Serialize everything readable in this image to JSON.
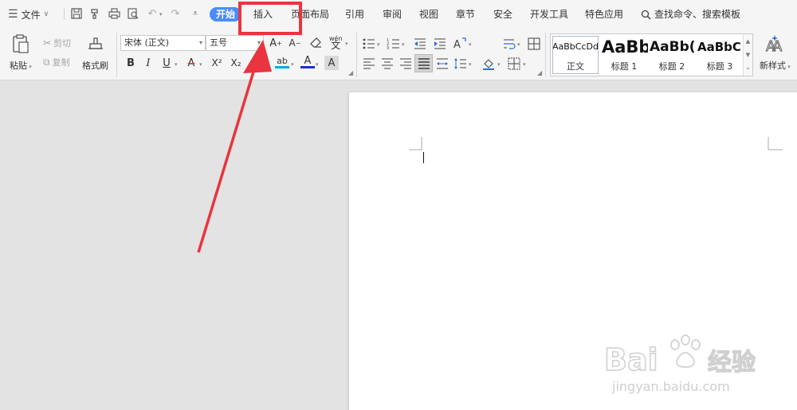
{
  "menubar": {
    "file_label": "文件",
    "tabs": [
      {
        "key": "home",
        "label": "开始",
        "active": true
      },
      {
        "key": "insert",
        "label": "插入",
        "active": false
      },
      {
        "key": "layout",
        "label": "页面布局",
        "active": false
      },
      {
        "key": "references",
        "label": "引用",
        "active": false
      },
      {
        "key": "review",
        "label": "审阅",
        "active": false
      },
      {
        "key": "view",
        "label": "视图",
        "active": false
      },
      {
        "key": "section",
        "label": "章节",
        "active": false
      },
      {
        "key": "security",
        "label": "安全",
        "active": false
      },
      {
        "key": "devtools",
        "label": "开发工具",
        "active": false
      },
      {
        "key": "features",
        "label": "特色应用",
        "active": false
      }
    ],
    "search_label": "查找命令、搜索模板",
    "quick_access_icons": [
      "save-icon",
      "format-painter-icon",
      "print-icon",
      "print-preview-icon",
      "undo-icon",
      "redo-icon",
      "customize-dropdown-icon"
    ]
  },
  "ribbon": {
    "paste_label": "粘贴",
    "cut_label": "剪切",
    "copy_label": "复制",
    "format_painter_label": "格式刷",
    "font_name": "宋体 (正文)",
    "font_size": "五号",
    "styles": [
      {
        "sample": "AaBbCcDd",
        "label": "正文",
        "selected": true
      },
      {
        "sample": "AaBb",
        "label": "标题 1",
        "selected": false
      },
      {
        "sample": "AaBb(",
        "label": "标题 2",
        "selected": false
      },
      {
        "sample": "AaBbC",
        "label": "标题 3",
        "selected": false
      }
    ],
    "new_style_label": "新样式",
    "grow_font_glyph": "A",
    "shrink_font_glyph": "A",
    "bold_glyph": "B",
    "italic_glyph": "I",
    "underline_glyph": "U",
    "strike_glyph": "A",
    "superscript_glyph": "X²",
    "subscript_glyph": "X₂",
    "text_effect_glyph": "A",
    "highlight_glyph": "ab",
    "font_color_glyph": "A",
    "char_shading_glyph": "A",
    "phonetic_glyph": "wén"
  },
  "watermark": {
    "brand": "Bai",
    "brand_cn": "经验",
    "url": "jingyan.baidu.com"
  },
  "colors": {
    "active_tab": "#4a8cf7",
    "annotation": "#e8353f",
    "canvas": "#e3e3e3",
    "ribbon": "#f5f5f5"
  }
}
